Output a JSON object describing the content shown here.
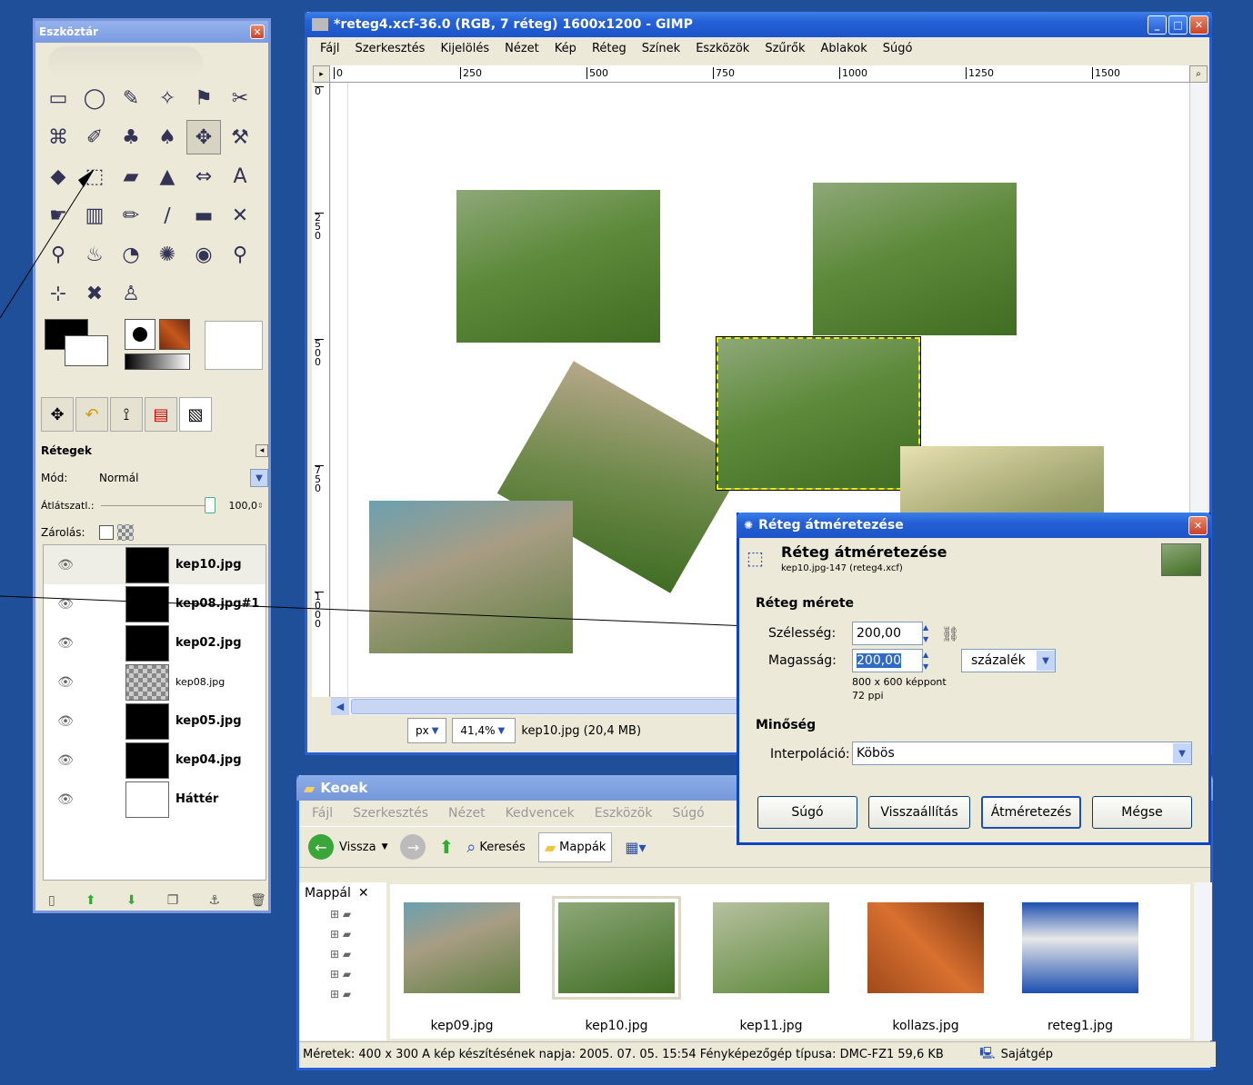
{
  "toolbox": {
    "title": "Eszköztár",
    "tools": [
      "▭",
      "◯",
      "✎",
      "✧",
      "⚑",
      "✂",
      "⌘",
      "✐",
      "♣",
      "♠",
      "✥",
      "⚒",
      "◆",
      "⬚",
      "▰",
      "▲",
      "⇔",
      "A",
      "☛",
      "▥",
      "✏",
      "∕",
      "▬",
      "✕",
      "⚲",
      "♨",
      "◔",
      "✺",
      "◉",
      "⚲",
      "⊹",
      "✖",
      "♙"
    ],
    "layers_title": "Rétegek",
    "mode_label": "Mód:",
    "mode_value": "Normál",
    "opacity_label": "Átlátszatl.:",
    "opacity_value": "100,0",
    "lock_label": "Zárolás:",
    "layers": [
      {
        "name": "kep10.jpg"
      },
      {
        "name": "kep08.jpg#1"
      },
      {
        "name": "kep02.jpg"
      },
      {
        "name": "kep08.jpg"
      },
      {
        "name": "kep05.jpg"
      },
      {
        "name": "kep04.jpg"
      },
      {
        "name": "Háttér"
      }
    ]
  },
  "gimp": {
    "title": "*reteg4.xcf-36.0 (RGB, 7 réteg) 1600x1200 - GIMP",
    "menu": [
      "Fájl",
      "Szerkesztés",
      "Kijelölés",
      "Nézet",
      "Kép",
      "Réteg",
      "Színek",
      "Eszközök",
      "Szűrők",
      "Ablakok",
      "Súgó"
    ],
    "ruler_ticks": [
      "0",
      "250",
      "500",
      "750",
      "1000",
      "1250",
      "1500"
    ],
    "ruler_v_ticks": [
      "0",
      "250",
      "500",
      "750",
      "1000"
    ],
    "unit": "px",
    "zoom": "41,4%",
    "status": "kep10.jpg (20,4 MB)"
  },
  "dialog": {
    "title": "Réteg átméretezése",
    "header": "Réteg átméretezése",
    "subheader": "kep10.jpg-147 (reteg4.xcf)",
    "size_section": "Réteg mérete",
    "width_label": "Szélesség:",
    "width_value": "200,00",
    "height_label": "Magasság:",
    "height_value": "200,00",
    "unit_value": "százalék",
    "pixels_info": "800 x 600 képpont",
    "ppi_info": "72 ppi",
    "quality_section": "Minőség",
    "interp_label": "Interpoláció:",
    "interp_value": "Köbös",
    "btn_help": "Súgó",
    "btn_reset": "Visszaállítás",
    "btn_resize": "Átméretezés",
    "btn_cancel": "Mégse"
  },
  "explorer": {
    "title": "Keoek",
    "menu": [
      "Fájl",
      "Szerkesztés",
      "Nézet",
      "Kedvencek",
      "Eszközök",
      "Súgó"
    ],
    "back": "Vissza",
    "search": "Keresés",
    "folders": "Mappák",
    "pane_title": "Mappál",
    "files": [
      "kep09.jpg",
      "kep10.jpg",
      "kep11.jpg",
      "kollazs.jpg",
      "reteg1.jpg"
    ],
    "status_main": "Méretek: 400 x 300 A kép készítésének napja: 2005. 07. 05. 15:54 Fényképezőgép típusa: DMC-FZ1",
    "status_size": "59,6 KB",
    "status_loc": "Sajátgép"
  }
}
